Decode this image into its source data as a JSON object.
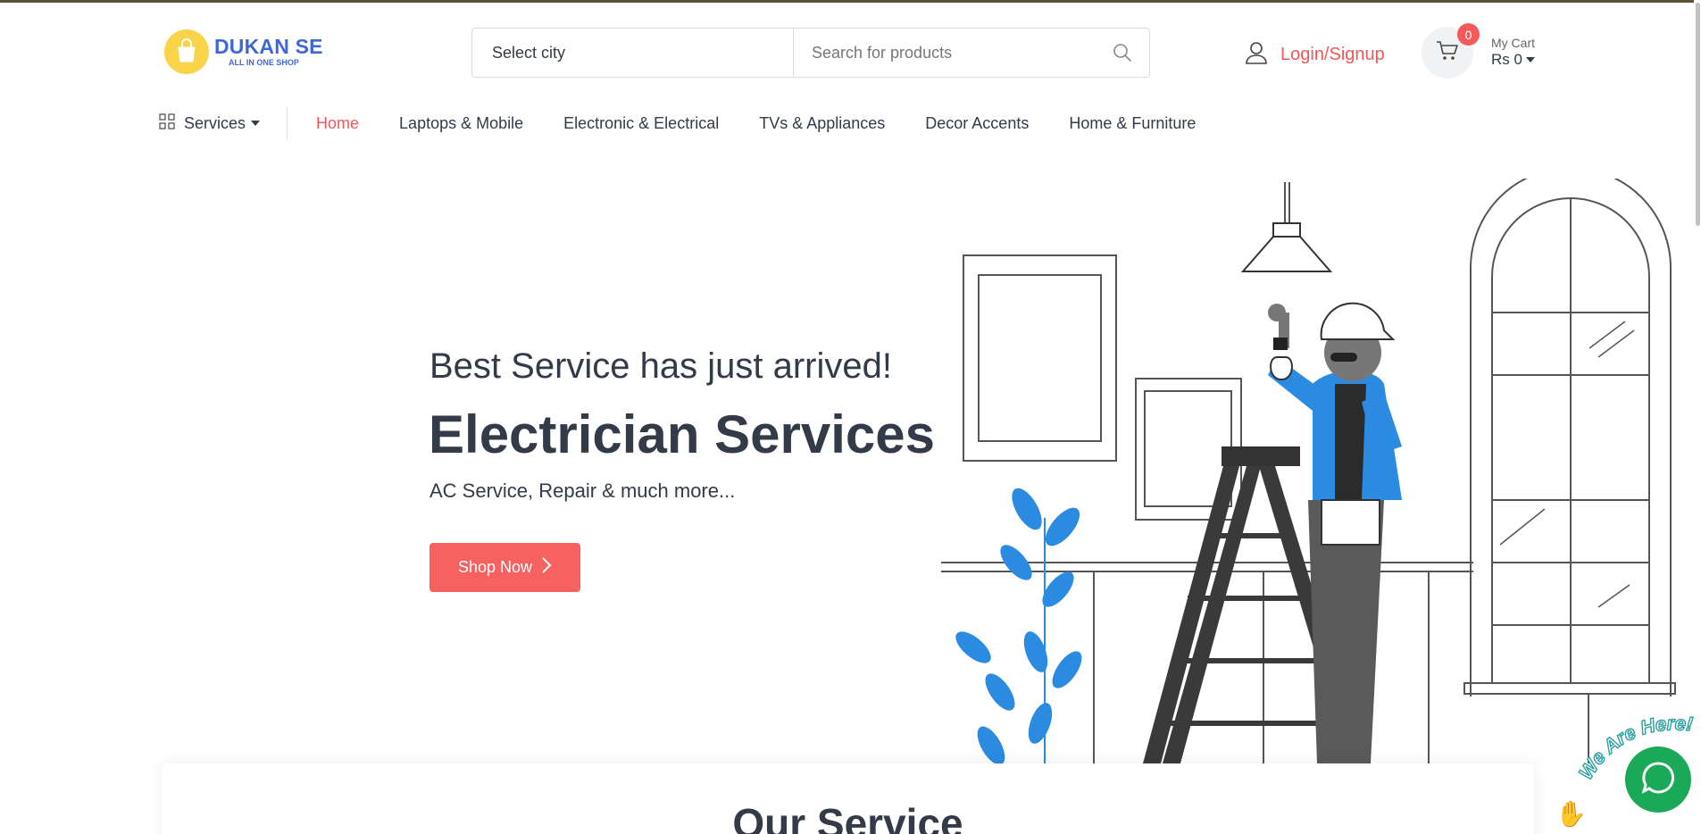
{
  "brand": {
    "name": "DUKAN SE",
    "tagline": "ALL IN ONE SHOP",
    "color": "#3f67d8",
    "logo_bg": "#f9d448"
  },
  "header": {
    "city_label": "Select city",
    "search_placeholder": "Search for products",
    "login_label": "Login/Signup",
    "cart": {
      "badge_count": "0",
      "label": "My Cart",
      "amount": "Rs 0"
    }
  },
  "nav": {
    "services_label": "Services",
    "links": [
      {
        "label": "Home",
        "active": true
      },
      {
        "label": "Laptops & Mobile",
        "active": false
      },
      {
        "label": "Electronic & Electrical",
        "active": false
      },
      {
        "label": "TVs & Appliances",
        "active": false
      },
      {
        "label": "Decor Accents",
        "active": false
      },
      {
        "label": "Home & Furniture",
        "active": false
      }
    ]
  },
  "hero": {
    "subtitle": "Best Service has just arrived!",
    "title": "Electrician Services",
    "description": "AC Service, Repair & much more...",
    "button_label": "Shop Now"
  },
  "section": {
    "title": "Our Service"
  },
  "chat": {
    "caption": "We Are Here!"
  },
  "colors": {
    "accent": "#f0585a",
    "button": "#f76260",
    "chat": "#1aa956",
    "illustration_blue": "#2a8be0"
  }
}
